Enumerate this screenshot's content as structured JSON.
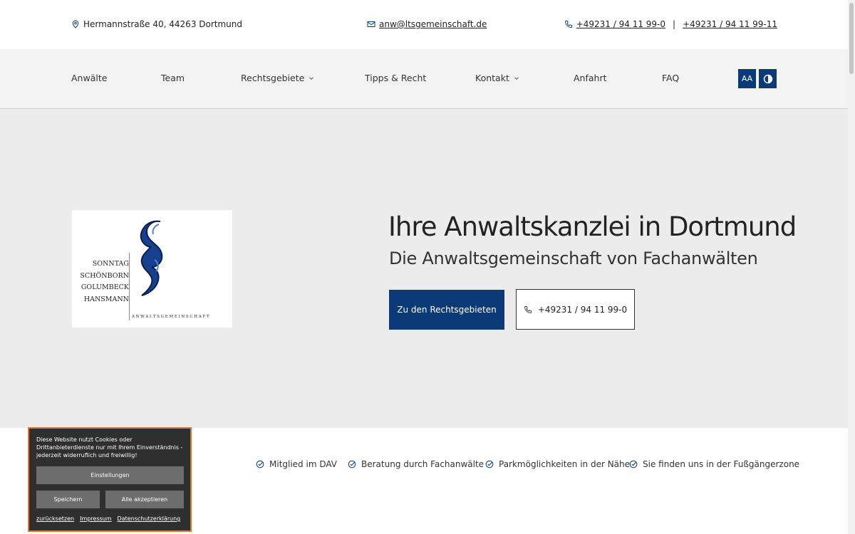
{
  "topbar": {
    "address": "Hermannstraße 40, 44263 Dortmund",
    "email": "anw@ltsgemeinschaft.de",
    "phone1": "+49231 / 94 11 99-0",
    "phone_separator": "|",
    "phone2": "+49231 / 94 11 99-11"
  },
  "nav": {
    "items": [
      "Anwälte",
      "Team",
      "Rechtsgebiete",
      "Tipps & Recht",
      "Kontakt",
      "Anfahrt",
      "FAQ"
    ],
    "font_size_label": "AA"
  },
  "logo": {
    "names": [
      "SONNTAG",
      "SCHÖNBORN",
      "GOLUMBECK",
      "HANSMANN"
    ],
    "subtitle": "ANWALTSGEMEINSCHAFT"
  },
  "hero": {
    "headline": "Ihre Anwaltskanzlei in Dortmund",
    "subline": "Die Anwaltsgemeinschaft von Fachanwälten",
    "primary_button": "Zu den Rechtsgebieten",
    "secondary_button": "+49231 / 94 11 99-0"
  },
  "features": [
    "Mitglied im DAV",
    "Beratung durch Fachanwälte",
    "Parkmöglichkeiten in der Nähe",
    "Sie finden uns in der Fußgängerzone"
  ],
  "cookie": {
    "text": "Diese Website nutzt Cookies oder Drittanbieterdienste nur mit Ihrem Einverständnis - jederzeit widerruflich und freiwillig!",
    "settings": "Einstellungen",
    "save": "Speichern",
    "accept_all": "Alle akzeptieren",
    "links": [
      "zurücksetzen",
      "Impressum",
      "Datenschutzerklärung"
    ]
  },
  "colors": {
    "brand_blue": "#0b3a78",
    "hero_bg": "#ececec",
    "nav_bg": "#f3f3f3",
    "cookie_border": "#e0762a"
  }
}
